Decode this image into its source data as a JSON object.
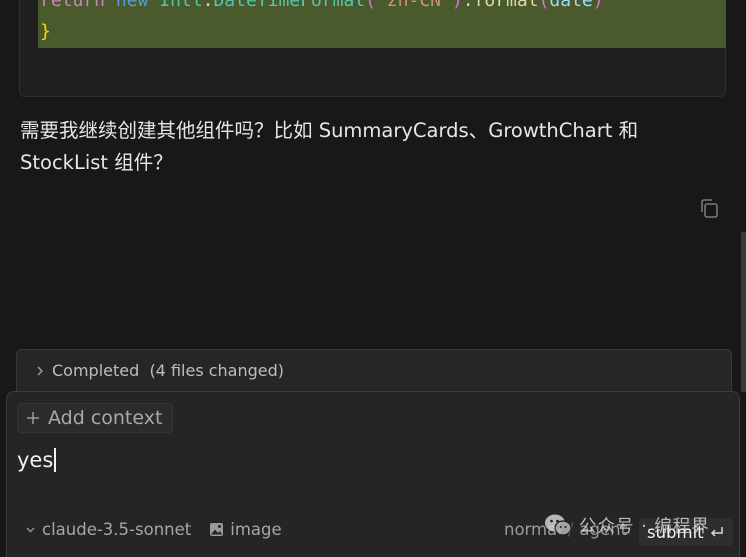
{
  "code": {
    "line1": {
      "t1": "return",
      "t2": " ",
      "t3": "new",
      "t4": " ",
      "t5": "Intl",
      "t6": ".",
      "t7": "DateTimeFormat",
      "t8": "(",
      "t9": "'zh-CN'",
      "t10": ")",
      "t11": ".",
      "t12": "format",
      "t13": "(",
      "t14": "date",
      "t15": ")"
    },
    "line2": "}"
  },
  "message": {
    "text": "需要我继续创建其他组件吗？比如 SummaryCards、GrowthChart 和 StockList 组件？"
  },
  "copy_button": {
    "icon": "copy-icon"
  },
  "completed": {
    "label": "Completed",
    "detail": "(4 files changed)"
  },
  "composer": {
    "add_context_label": "Add context",
    "input_value": "yes",
    "model": "claude-3.5-sonnet",
    "image_label": "image",
    "mode_normal": "normal",
    "mode_separator": "/",
    "mode_agent": "agent",
    "submit_label": "submit"
  },
  "watermark": {
    "text": "公众号 · 编程界"
  },
  "colors": {
    "background": "#181818",
    "code_highlight": "#4a5a2c",
    "panel": "#252525"
  }
}
